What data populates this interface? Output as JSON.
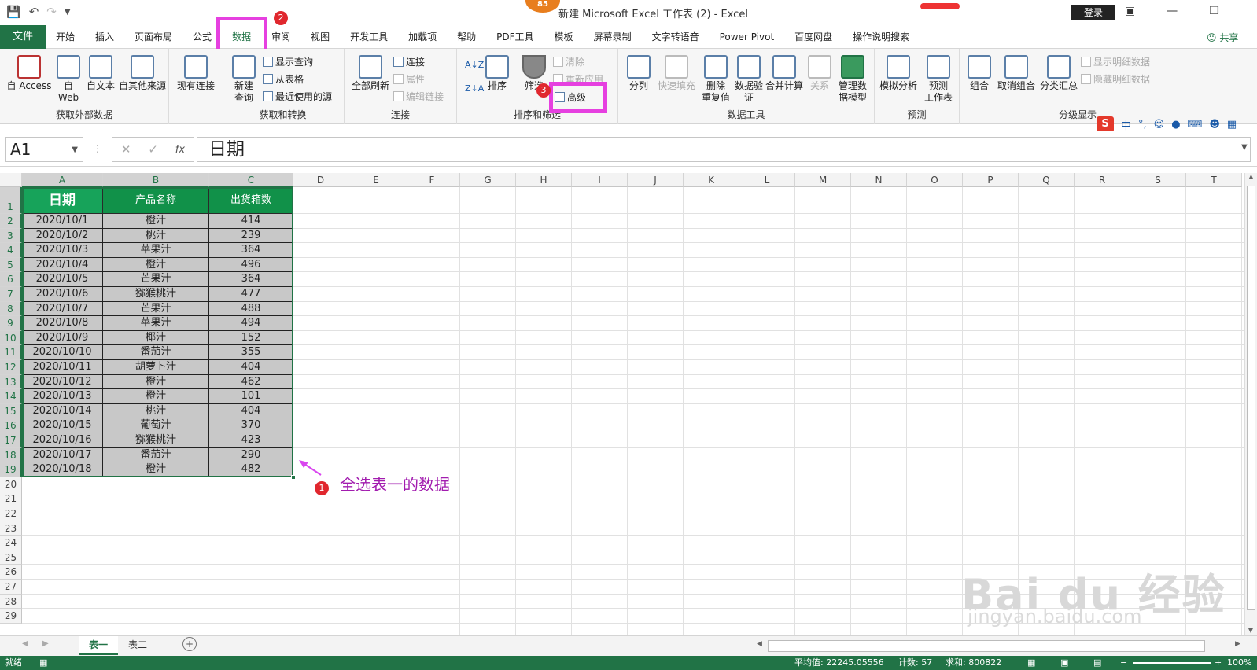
{
  "titlebar": {
    "badge": "85",
    "title": "新建 Microsoft Excel 工作表 (2)  -  Excel",
    "login": "登录"
  },
  "tabs": {
    "file": "文件",
    "items": [
      "开始",
      "插入",
      "页面布局",
      "公式",
      "数据",
      "审阅",
      "视图",
      "开发工具",
      "加载项",
      "帮助",
      "PDF工具",
      "模板",
      "屏幕录制",
      "文字转语音",
      "Power Pivot",
      "百度网盘",
      "操作说明搜索"
    ],
    "active": "数据",
    "share": "共享"
  },
  "ribbon": {
    "groups": {
      "external": "获取外部数据",
      "transform": "获取和转换",
      "connections": "连接",
      "sortfilter": "排序和筛选",
      "datatools": "数据工具",
      "forecast": "预测",
      "outline": "分级显示"
    },
    "buttons": {
      "access": "自 Access",
      "web1": "自",
      "web2": "Web",
      "text": "自文本",
      "other": "自其他来源",
      "existing": "现有连接",
      "newquery1": "新建",
      "newquery2": "查询",
      "showquery": "显示查询",
      "fromtable": "从表格",
      "recent": "最近使用的源",
      "refreshall": "全部刷新",
      "connections": "连接",
      "properties": "属性",
      "editlinks": "编辑链接",
      "sort": "排序",
      "filter": "筛选",
      "clear": "清除",
      "reapply": "重新应用",
      "advanced": "高级",
      "split": "分列",
      "flashfill": "快速填充",
      "removedup1": "删除",
      "removedup2": "重复值",
      "validation1": "数据验",
      "validation2": "证",
      "consolidate": "合并计算",
      "relations": "关系",
      "model1": "管理数",
      "model2": "据模型",
      "whatif": "模拟分析",
      "forecast1": "预测",
      "forecast2": "工作表",
      "group": "组合",
      "ungroup": "取消组合",
      "subtotal": "分类汇总",
      "showdetail": "显示明细数据",
      "hidedetail": "隐藏明细数据"
    },
    "ime": "中"
  },
  "formula": {
    "cell": "A1",
    "fx": "fx",
    "value": "日期"
  },
  "columns": [
    "A",
    "B",
    "C",
    "D",
    "E",
    "F",
    "G",
    "H",
    "I",
    "J",
    "K",
    "L",
    "M",
    "N",
    "O",
    "P",
    "Q",
    "R",
    "S",
    "T"
  ],
  "table": {
    "headers": [
      "日期",
      "产品名称",
      "出货箱数"
    ],
    "rows": [
      [
        "2020/10/1",
        "橙汁",
        "414"
      ],
      [
        "2020/10/2",
        "桃汁",
        "239"
      ],
      [
        "2020/10/3",
        "苹果汁",
        "364"
      ],
      [
        "2020/10/4",
        "橙汁",
        "496"
      ],
      [
        "2020/10/5",
        "芒果汁",
        "364"
      ],
      [
        "2020/10/6",
        "猕猴桃汁",
        "477"
      ],
      [
        "2020/10/7",
        "芒果汁",
        "488"
      ],
      [
        "2020/10/8",
        "苹果汁",
        "494"
      ],
      [
        "2020/10/9",
        "椰汁",
        "152"
      ],
      [
        "2020/10/10",
        "番茄汁",
        "355"
      ],
      [
        "2020/10/11",
        "胡萝卜汁",
        "404"
      ],
      [
        "2020/10/12",
        "橙汁",
        "462"
      ],
      [
        "2020/10/13",
        "橙汁",
        "101"
      ],
      [
        "2020/10/14",
        "桃汁",
        "404"
      ],
      [
        "2020/10/15",
        "葡萄汁",
        "370"
      ],
      [
        "2020/10/16",
        "猕猴桃汁",
        "423"
      ],
      [
        "2020/10/17",
        "番茄汁",
        "290"
      ],
      [
        "2020/10/18",
        "橙汁",
        "482"
      ]
    ]
  },
  "annotations": {
    "step1": "1",
    "step2": "2",
    "step3": "3",
    "note": "全选表一的数据"
  },
  "sheets": [
    "表一",
    "表二"
  ],
  "status": {
    "ready": "就绪",
    "average": "平均值: 22245.05556",
    "count": "计数: 57",
    "sum": "求和: 800822",
    "zoom": "100%"
  },
  "watermark": {
    "brand": "Bai du 经验",
    "url": "jingyan.baidu.com"
  }
}
